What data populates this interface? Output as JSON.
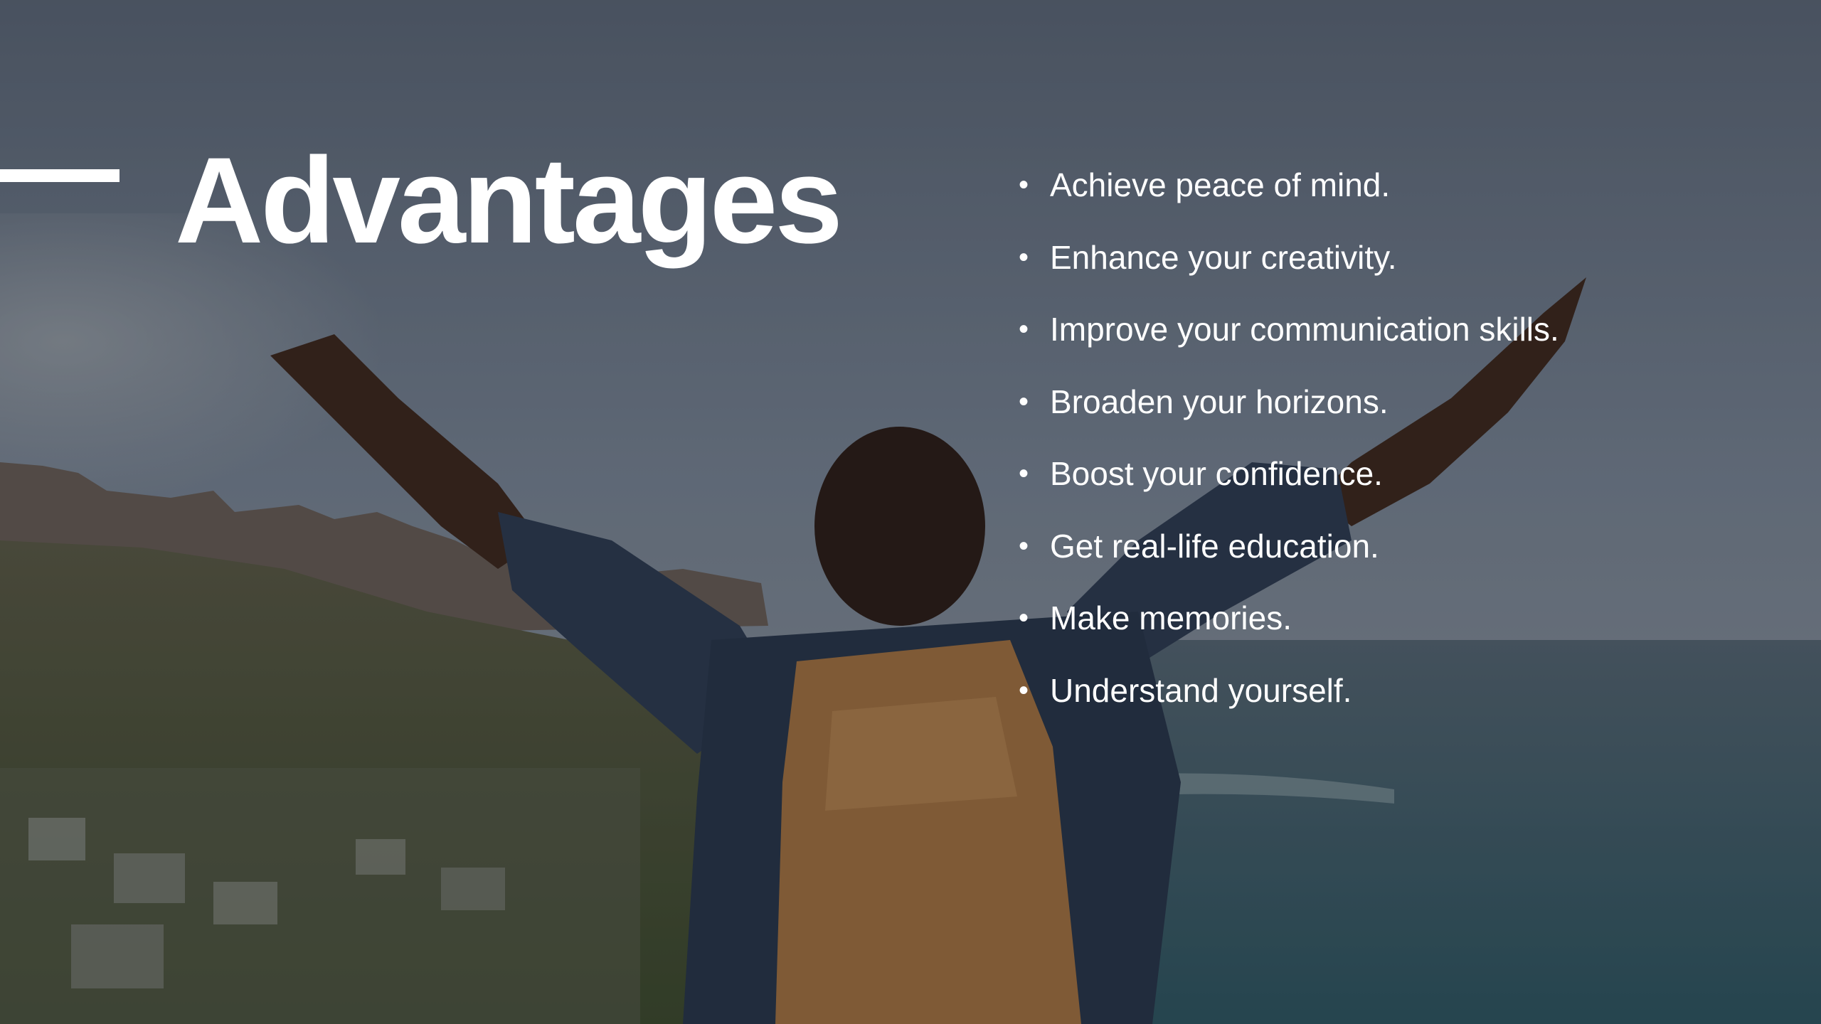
{
  "slide": {
    "title": "Advantages",
    "bullet_symbol": "•",
    "bullets": [
      "Achieve peace of mind.",
      "Enhance your creativity.",
      "Improve your communication skills.",
      "Broaden your horizons.",
      "Boost your confidence.",
      "Get real-life education.",
      "Make memories.",
      "Understand yourself."
    ]
  },
  "background": {
    "icon": "traveler-photo",
    "colors": {
      "sky": "#6b7787",
      "mountain": "#5a5048",
      "sea": "#3c5a66",
      "vegetation": "#4f5a34",
      "shirt": "#2a3a52",
      "backpack": "#b07a44",
      "skin": "#3a2418"
    }
  }
}
